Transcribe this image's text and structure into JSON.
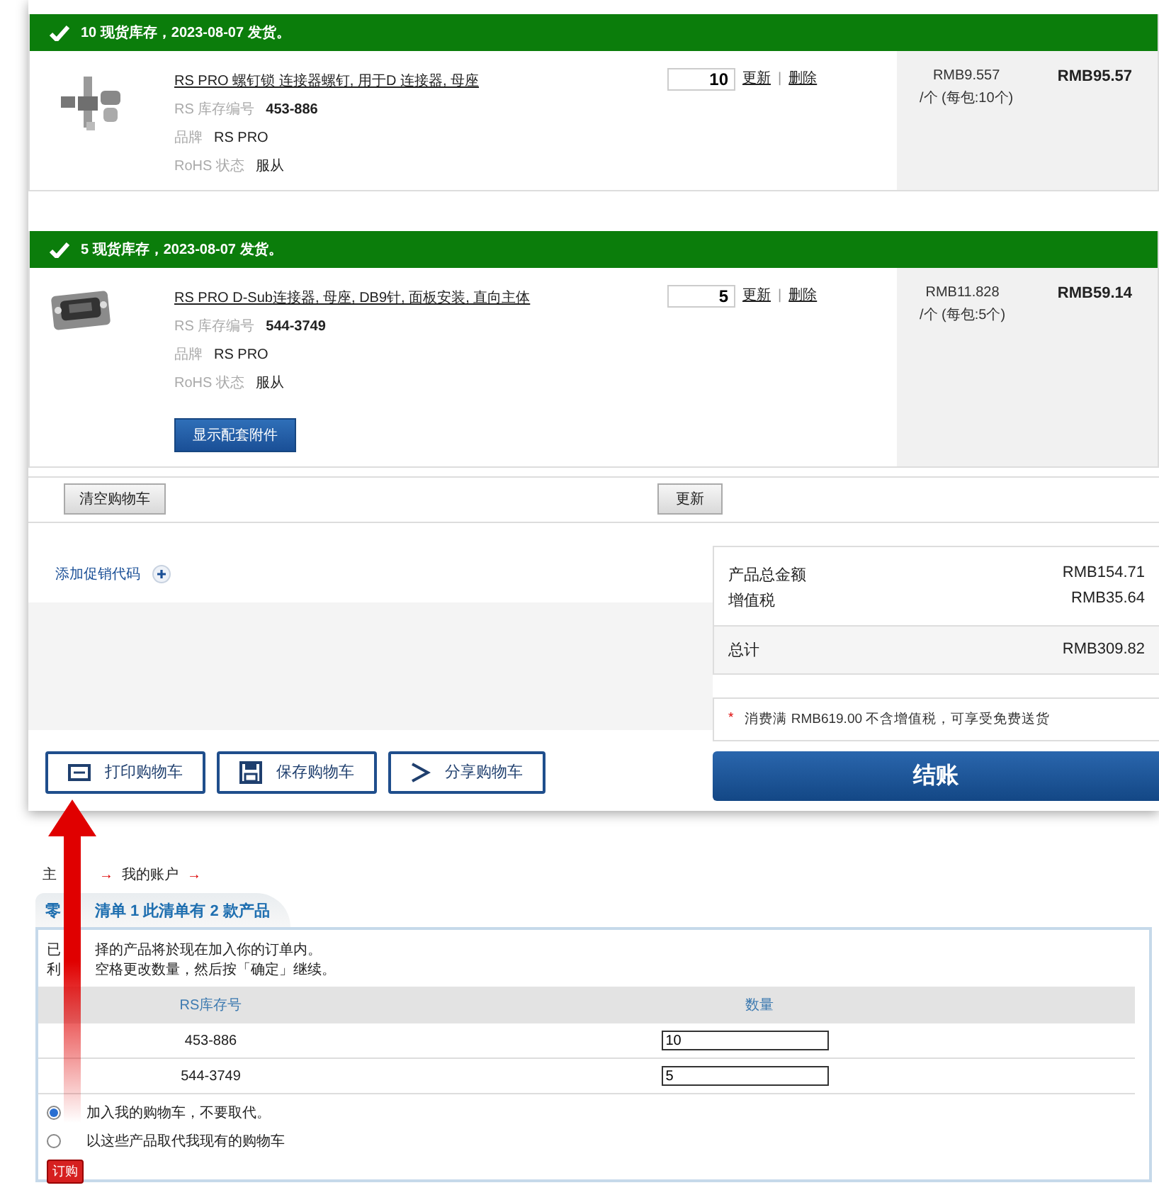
{
  "items": [
    {
      "stock_note": "10 现货库存，2023-08-07 发货。",
      "title": "RS PRO 螺钉锁 连接器螺钉, 用于D 连接器, 母座",
      "stock_no_label": "RS 库存编号",
      "stock_no": "453-886",
      "brand_label": "品牌",
      "brand": "RS PRO",
      "rohs_label": "RoHS 状态",
      "rohs": "服从",
      "quantity": "10",
      "update_link": "更新",
      "separator": "|",
      "delete_link": "删除",
      "unit_price": "RMB9.557",
      "unit_note": "/个 (每包:10个)",
      "line_total": "RMB95.57",
      "kind": "screw"
    },
    {
      "stock_note": "5 现货库存，2023-08-07 发货。",
      "title": "RS PRO D-Sub连接器, 母座, DB9针, 面板安装, 直向主体",
      "stock_no_label": "RS 库存编号",
      "stock_no": "544-3749",
      "brand_label": "品牌",
      "brand": "RS PRO",
      "rohs_label": "RoHS 状态",
      "rohs": "服从",
      "quantity": "5",
      "update_link": "更新",
      "separator": "|",
      "delete_link": "删除",
      "unit_price": "RMB11.828",
      "unit_note": "/个 (每包:5个)",
      "line_total": "RMB59.14",
      "kind": "connector",
      "accessories_button": "显示配套附件"
    }
  ],
  "cart_actions": {
    "clear": "清空购物车",
    "update": "更新"
  },
  "promo": {
    "label": "添加促销代码"
  },
  "summary": {
    "rows": [
      {
        "label": "产品总金额",
        "value": "RMB154.71"
      },
      {
        "label": "增值税",
        "value": "RMB35.64"
      }
    ],
    "total": {
      "label": "总计",
      "value": "RMB309.82"
    },
    "note_mark": "*",
    "note": "消费满 RMB619.00 不含增值税，可享受免费送货"
  },
  "actions": [
    {
      "kind": "print",
      "label": "打印购物车"
    },
    {
      "kind": "save",
      "label": "保存购物车"
    },
    {
      "kind": "share",
      "label": "分享购物车"
    }
  ],
  "checkout": "结账",
  "order_list": {
    "breadcrumb": [
      {
        "label": "主",
        "separator": "→"
      },
      {
        "label": "我的账户",
        "separator": "→"
      }
    ],
    "tab_parts": [
      "零",
      "清单 1 此清单有 2 款产品"
    ],
    "intro": [
      {
        "parts": [
          "已",
          "择的产品将於现在加入你的订单内。"
        ]
      },
      {
        "parts": [
          "利",
          "空格更改数量，然后按「确定」继续。"
        ]
      }
    ],
    "columns": [
      "RS库存号",
      "数量"
    ],
    "rows": [
      {
        "stock_no": "453-886",
        "quantity": "10"
      },
      {
        "stock_no": "544-3749",
        "quantity": "5"
      }
    ],
    "options": [
      {
        "label": "加入我的购物车，不要取代。",
        "selected": true
      },
      {
        "label": "以这些产品取代我现有的购物车",
        "selected": false
      }
    ],
    "order_button": "订购"
  }
}
